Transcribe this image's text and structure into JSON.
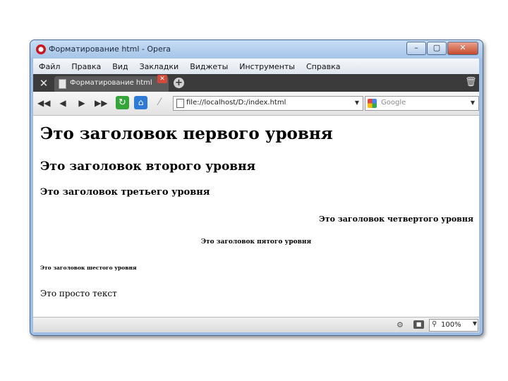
{
  "window": {
    "title": "Форматирование html - Opera"
  },
  "menu": [
    "Файл",
    "Правка",
    "Вид",
    "Закладки",
    "Виджеты",
    "Инструменты",
    "Справка"
  ],
  "tabs": [
    {
      "label": "Форматирование html"
    }
  ],
  "toolbar": {
    "address": "file://localhost/D:/index.html",
    "search_placeholder": "Google"
  },
  "content": {
    "h1": "Это заголовок первого уровня",
    "h2": "Это заголовок второго уровня",
    "h3": "Это заголовок третьего уровня",
    "h4": "Это заголовок четвертого уровня",
    "h5": "Это заголовок пятого уровня",
    "h6": "Это заголовок шестого уровня",
    "paragraph": "Это просто текст"
  },
  "status": {
    "zoom": "100%"
  },
  "colors": {
    "tabbar": "#3b3b3b",
    "frame": "#9fc0e4",
    "close_button": "#c64a2c"
  }
}
